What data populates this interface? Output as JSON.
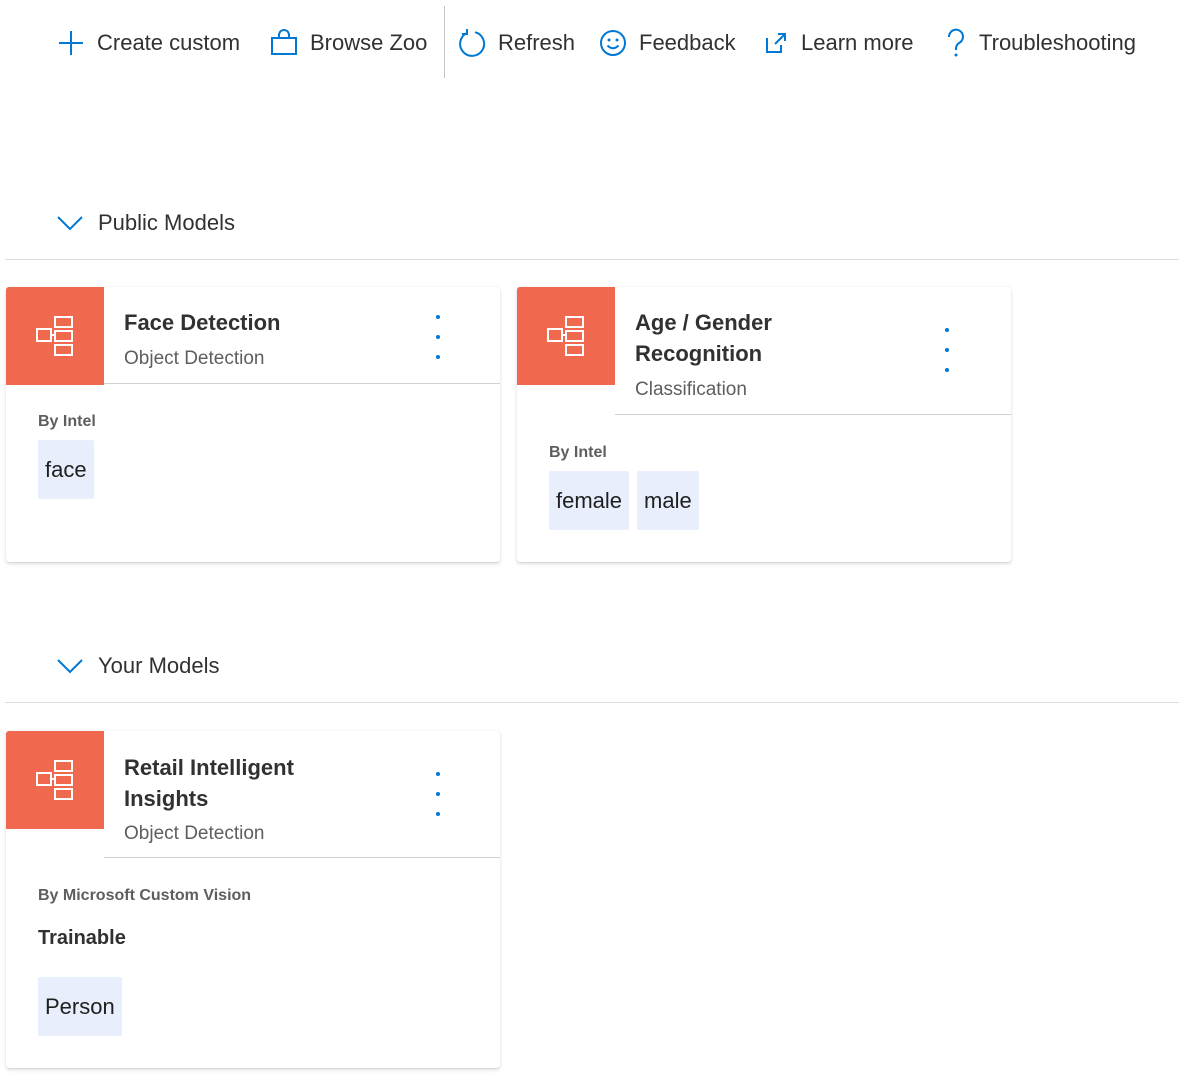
{
  "toolbar": {
    "create_custom": "Create custom",
    "browse_zoo": "Browse Zoo",
    "refresh": "Refresh",
    "feedback": "Feedback",
    "learn_more": "Learn more",
    "troubleshooting": "Troubleshooting",
    "icon_color": "#0078d4"
  },
  "sections": {
    "public": {
      "label": "Public Models"
    },
    "yours": {
      "label": "Your Models"
    }
  },
  "cards": {
    "face": {
      "title": "Face Detection",
      "subtitle": "Object Detection",
      "by": "By Intel",
      "tags": [
        "face"
      ]
    },
    "age": {
      "title": "Age / Gender Recognition",
      "subtitle": "Classification",
      "by": "By Intel",
      "tags": [
        "female",
        "male"
      ]
    },
    "retail": {
      "title": "Retail Intelligent Insights",
      "subtitle": "Object Detection",
      "by": "By Microsoft Custom Vision",
      "trainable": "Trainable",
      "tags": [
        "Person"
      ]
    }
  },
  "colors": {
    "accent": "#0078d4",
    "card_icon_bg": "#f0684d",
    "tag_bg": "#e8eefc"
  }
}
